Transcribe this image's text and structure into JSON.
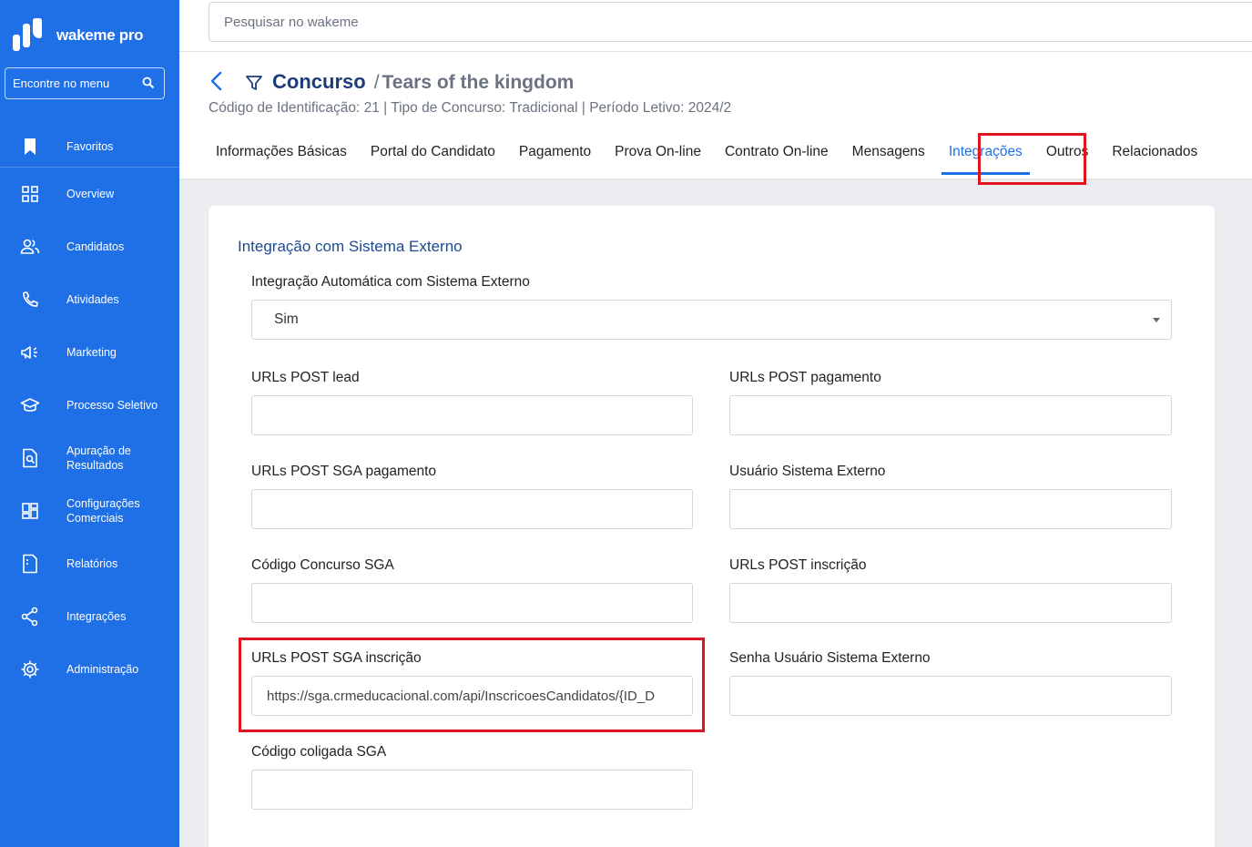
{
  "app": {
    "brand": "wakeme pro"
  },
  "sidebar": {
    "search_placeholder": "Encontre no menu",
    "favorites_label": "Favoritos",
    "items": [
      {
        "label": "Overview",
        "icon": "grid-icon"
      },
      {
        "label": "Candidatos",
        "icon": "users-icon"
      },
      {
        "label": "Atividades",
        "icon": "phone-icon"
      },
      {
        "label": "Marketing",
        "icon": "megaphone-icon"
      },
      {
        "label": "Processo Seletivo",
        "icon": "graduation-cap-icon"
      },
      {
        "label": "Apuração de\nResultados",
        "icon": "document-search-icon"
      },
      {
        "label": "Configurações\nComerciais",
        "icon": "layout-grid-icon"
      },
      {
        "label": "Relatórios",
        "icon": "report-icon"
      },
      {
        "label": "Integrações",
        "icon": "share-icon"
      },
      {
        "label": "Administração",
        "icon": "gear-icon"
      }
    ]
  },
  "topbar": {
    "search_placeholder": "Pesquisar no wakeme"
  },
  "header": {
    "title": "Concurso",
    "separator": "/",
    "subtitle": "Tears of the kingdom",
    "info": "Código de Identificação: 21 | Tipo de Concurso: Tradicional | Período Letivo: 2024/2",
    "tabs": [
      {
        "label": "Informações Básicas",
        "active": false
      },
      {
        "label": "Portal do Candidato",
        "active": false
      },
      {
        "label": "Pagamento",
        "active": false
      },
      {
        "label": "Prova On-line",
        "active": false
      },
      {
        "label": "Contrato On-line",
        "active": false
      },
      {
        "label": "Mensagens",
        "active": false
      },
      {
        "label": "Integrações",
        "active": true
      },
      {
        "label": "Outros",
        "active": false
      },
      {
        "label": "Relacionados",
        "active": false
      }
    ]
  },
  "form": {
    "section_title": "Integração com Sistema Externo",
    "auto_integration": {
      "label": "Integração Automática com Sistema Externo",
      "value": "Sim"
    },
    "fields": {
      "urls_post_lead": {
        "label": "URLs POST lead",
        "value": ""
      },
      "urls_post_pagamento": {
        "label": "URLs POST pagamento",
        "value": ""
      },
      "urls_post_sga_pagamento": {
        "label": "URLs POST SGA pagamento",
        "value": ""
      },
      "usuario_sistema_externo": {
        "label": "Usuário Sistema Externo",
        "value": ""
      },
      "codigo_concurso_sga": {
        "label": "Código Concurso SGA",
        "value": ""
      },
      "urls_post_inscricao": {
        "label": "URLs POST inscrição",
        "value": ""
      },
      "urls_post_sga_inscricao": {
        "label": "URLs POST SGA inscrição",
        "value": "https://sga.crmeducacional.com/api/InscricoesCandidatos/{ID_D"
      },
      "senha_usuario_sistema_externo": {
        "label": "Senha Usuário Sistema Externo",
        "value": ""
      },
      "codigo_coligada_sga": {
        "label": "Código coligada SGA",
        "value": ""
      }
    }
  },
  "colors": {
    "sidebar": "#1f6fe6",
    "accent": "#1f6fe6",
    "title": "#1c3d7a",
    "highlight": "#e0151f"
  }
}
